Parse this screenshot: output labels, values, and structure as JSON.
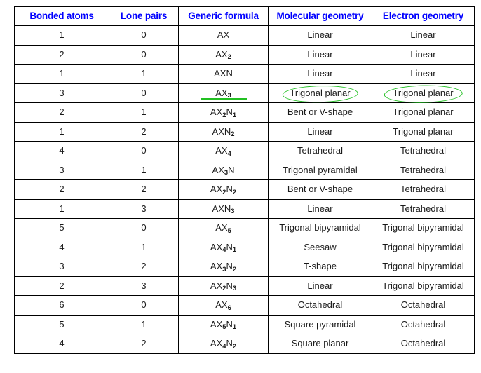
{
  "table": {
    "headers": [
      "Bonded atoms",
      "Lone pairs",
      "Generic formula",
      "Molecular geometry",
      "Electron geometry"
    ],
    "rows": [
      {
        "bonded": "1",
        "lone": "0",
        "formula_base": "AX",
        "formula_parts": [
          {
            "t": "AX",
            "sub": ""
          }
        ],
        "molecular": "Linear",
        "electron": "Linear"
      },
      {
        "bonded": "2",
        "lone": "0",
        "formula_base": "AX2",
        "formula_parts": [
          {
            "t": "AX",
            "sub": "2"
          }
        ],
        "molecular": "Linear",
        "electron": "Linear"
      },
      {
        "bonded": "1",
        "lone": "1",
        "formula_base": "AXN",
        "formula_parts": [
          {
            "t": "AXN",
            "sub": ""
          }
        ],
        "molecular": "Linear",
        "electron": "Linear"
      },
      {
        "bonded": "3",
        "lone": "0",
        "formula_base": "AX3",
        "formula_parts": [
          {
            "t": "AX",
            "sub": "3"
          }
        ],
        "molecular": "Trigonal planar",
        "electron": "Trigonal planar"
      },
      {
        "bonded": "2",
        "lone": "1",
        "formula_base": "AX2N1",
        "formula_parts": [
          {
            "t": "AX",
            "sub": "2"
          },
          {
            "t": "N",
            "sub": "1"
          }
        ],
        "molecular": "Bent or V-shape",
        "electron": "Trigonal planar"
      },
      {
        "bonded": "1",
        "lone": "2",
        "formula_base": "AXN2",
        "formula_parts": [
          {
            "t": "AXN",
            "sub": "2"
          }
        ],
        "molecular": "Linear",
        "electron": "Trigonal planar"
      },
      {
        "bonded": "4",
        "lone": "0",
        "formula_base": "AX4",
        "formula_parts": [
          {
            "t": "AX",
            "sub": "4"
          }
        ],
        "molecular": "Tetrahedral",
        "electron": "Tetrahedral"
      },
      {
        "bonded": "3",
        "lone": "1",
        "formula_base": "AX3N",
        "formula_parts": [
          {
            "t": "AX",
            "sub": "3"
          },
          {
            "t": "N",
            "sub": ""
          }
        ],
        "molecular": "Trigonal pyramidal",
        "electron": "Tetrahedral"
      },
      {
        "bonded": "2",
        "lone": "2",
        "formula_base": "AX2N2",
        "formula_parts": [
          {
            "t": "AX",
            "sub": "2"
          },
          {
            "t": "N",
            "sub": "2"
          }
        ],
        "molecular": "Bent or V-shape",
        "electron": "Tetrahedral"
      },
      {
        "bonded": "1",
        "lone": "3",
        "formula_base": "AXN3",
        "formula_parts": [
          {
            "t": "AXN",
            "sub": "3"
          }
        ],
        "molecular": "Linear",
        "electron": "Tetrahedral"
      },
      {
        "bonded": "5",
        "lone": "0",
        "formula_base": "AX5",
        "formula_parts": [
          {
            "t": "AX",
            "sub": "5"
          }
        ],
        "molecular": "Trigonal bipyramidal",
        "electron": "Trigonal bipyramidal"
      },
      {
        "bonded": "4",
        "lone": "1",
        "formula_base": "AX4N1",
        "formula_parts": [
          {
            "t": "AX",
            "sub": "4"
          },
          {
            "t": "N",
            "sub": "1"
          }
        ],
        "molecular": "Seesaw",
        "electron": "Trigonal bipyramidal"
      },
      {
        "bonded": "3",
        "lone": "2",
        "formula_base": "AX3N2",
        "formula_parts": [
          {
            "t": "AX",
            "sub": "3"
          },
          {
            "t": "N",
            "sub": "2"
          }
        ],
        "molecular": "T-shape",
        "electron": "Trigonal bipyramidal"
      },
      {
        "bonded": "2",
        "lone": "3",
        "formula_base": "AX2N3",
        "formula_parts": [
          {
            "t": "AX",
            "sub": "2"
          },
          {
            "t": "N",
            "sub": "3"
          }
        ],
        "molecular": "Linear",
        "electron": "Trigonal bipyramidal"
      },
      {
        "bonded": "6",
        "lone": "0",
        "formula_base": "AX6",
        "formula_parts": [
          {
            "t": "AX",
            "sub": "6"
          }
        ],
        "molecular": "Octahedral",
        "electron": "Octahedral"
      },
      {
        "bonded": "5",
        "lone": "1",
        "formula_base": "AX5N1",
        "formula_parts": [
          {
            "t": "AX",
            "sub": "5"
          },
          {
            "t": "N",
            "sub": "1"
          }
        ],
        "molecular": "Square pyramidal",
        "electron": "Octahedral"
      },
      {
        "bonded": "4",
        "lone": "2",
        "formula_base": "AX4N2",
        "formula_parts": [
          {
            "t": "AX",
            "sub": "4"
          },
          {
            "t": "N",
            "sub": "2"
          }
        ],
        "molecular": "Square planar",
        "electron": "Octahedral"
      }
    ],
    "annotations": {
      "highlight_color": "#22c022",
      "underlined_row_index": 3,
      "circled_row_index": 3,
      "circled_columns": [
        "molecular",
        "electron"
      ]
    },
    "colors": {
      "header_text": "#0000ff",
      "formula_text": "#ff0000",
      "body_text": "#1a1a1a",
      "border": "#000000",
      "background": "#ffffff"
    }
  }
}
